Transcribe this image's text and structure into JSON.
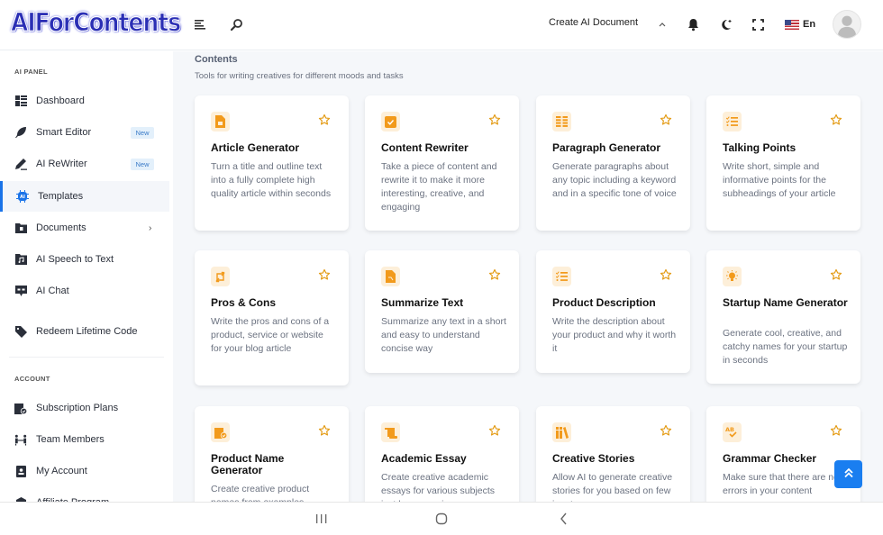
{
  "header": {
    "logo": "AIForContents",
    "create_doc_label": "Create AI Document",
    "language": "En",
    "icons": {
      "menu": "menu-lines-icon",
      "search": "search-icon",
      "chevron": "chevron-up-icon",
      "notifications": "bell-icon",
      "theme": "moon-icon",
      "fullscreen": "fullscreen-icon",
      "flag": "us-flag-icon",
      "avatar": "user-avatar-icon"
    }
  },
  "sidebar": {
    "sections": [
      {
        "title": "AI PANEL"
      },
      {
        "title": "ACCOUNT"
      }
    ],
    "items": [
      {
        "label": "Dashboard",
        "icon": "dashboard-icon"
      },
      {
        "label": "Smart Editor",
        "icon": "feather-icon",
        "badge": "New"
      },
      {
        "label": "AI ReWriter",
        "icon": "pen-icon",
        "badge": "New"
      },
      {
        "label": "Templates",
        "icon": "ai-chip-icon",
        "active": true
      },
      {
        "label": "Documents",
        "icon": "folder-icon",
        "chevron": "›"
      },
      {
        "label": "AI Speech to Text",
        "icon": "music-folder-icon"
      },
      {
        "label": "AI Chat",
        "icon": "chat-icon"
      },
      {
        "label": "Redeem Lifetime Code",
        "icon": "tag-icon"
      },
      {
        "label": "Subscription Plans",
        "icon": "gift-box-icon"
      },
      {
        "label": "Team Members",
        "icon": "team-icon"
      },
      {
        "label": "My Account",
        "icon": "id-badge-icon"
      },
      {
        "label": "Affiliate Program",
        "icon": "affiliate-icon"
      }
    ]
  },
  "main": {
    "title": "Contents",
    "subtitle": "Tools for writing creatives for different moods and tasks",
    "cards": [
      {
        "title": "Article Generator",
        "desc": "Turn a title and outline text into a fully complete high quality article within seconds",
        "icon": "document-icon"
      },
      {
        "title": "Content Rewriter",
        "desc": "Take a piece of content and rewrite it to make it more interesting, creative, and engaging",
        "icon": "checkbox-icon"
      },
      {
        "title": "Paragraph Generator",
        "desc": "Generate paragraphs about any topic including a keyword and in a specific tone of voice",
        "icon": "paragraph-icon"
      },
      {
        "title": "Talking Points",
        "desc": "Write short, simple and informative points for the subheadings of your article",
        "icon": "checklist-icon"
      },
      {
        "title": "Pros & Cons",
        "desc": "Write the pros and cons of a product, service or website for your blog article",
        "icon": "exchange-icon"
      },
      {
        "title": "Summarize Text",
        "desc": "Summarize any text in a short and easy to understand concise way",
        "icon": "file-text-icon"
      },
      {
        "title": "Product Description",
        "desc": "Write the description about your product and why it worth it",
        "icon": "checklist-icon"
      },
      {
        "title": "Startup Name Generator",
        "desc": "Generate cool, creative, and catchy names for your startup in seconds",
        "icon": "lightbulb-icon"
      },
      {
        "title": "Product Name Generator",
        "desc": "Create creative product names from examples",
        "icon": "gift-check-icon"
      },
      {
        "title": "Academic Essay",
        "desc": "Create creative academic essays for various subjects just by answering",
        "icon": "scroll-icon"
      },
      {
        "title": "Creative Stories",
        "desc": "Allow AI to generate creative stories for you based on few inputs",
        "icon": "books-icon"
      },
      {
        "title": "Grammar Checker",
        "desc": "Make sure that there are no errors in your content",
        "icon": "spellcheck-icon"
      }
    ]
  },
  "scroll_top": {
    "icon": "double-chevron-up-icon"
  },
  "android_nav": {
    "recents": "recents-icon",
    "home": "home-icon",
    "back": "back-icon"
  },
  "colors": {
    "accent": "#1a73e8",
    "icon_orange": "#f29a1b",
    "icon_bg": "#fdefd9",
    "badge_bg": "#e3f0fb"
  }
}
